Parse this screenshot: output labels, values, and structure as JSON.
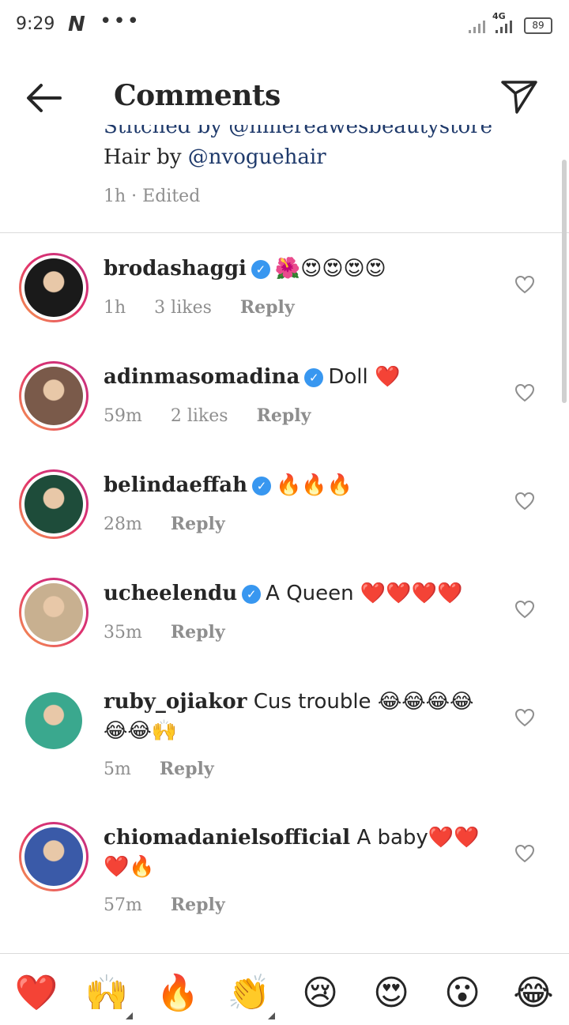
{
  "status": {
    "time": "9:29",
    "net": "4G",
    "battery": "89"
  },
  "header": {
    "title": "Comments",
    "back_icon": "arrow-left-icon",
    "send_icon": "paper-plane-icon"
  },
  "caption": {
    "cut_line": "Stitched by @nmereawesbeautystore",
    "line_prefix": "Hair by ",
    "mention": "@nvoguehair",
    "time": "1h",
    "sep": " · ",
    "edited": "Edited"
  },
  "comments": [
    {
      "user": "brodashaggi",
      "verified": true,
      "text": "🌺😍😍😍😍",
      "text2": "",
      "time": "1h",
      "likes": "3 likes",
      "reply": "Reply",
      "avatar_color": "#1a1a1a",
      "ring": true
    },
    {
      "user": "adinmasomadina",
      "verified": true,
      "text": "Doll ❤️",
      "text2": "",
      "time": "59m",
      "likes": "2 likes",
      "reply": "Reply",
      "avatar_color": "#7a5a4a",
      "ring": true
    },
    {
      "user": "belindaeffah",
      "verified": true,
      "text": "🔥🔥🔥",
      "text2": "",
      "time": "28m",
      "likes": "",
      "reply": "Reply",
      "avatar_color": "#1e4c3a",
      "ring": true
    },
    {
      "user": "ucheelendu",
      "verified": true,
      "text": "A Queen ❤️❤️❤️❤️",
      "text2": "",
      "time": "35m",
      "likes": "",
      "reply": "Reply",
      "avatar_color": "#c8b090",
      "ring": true
    },
    {
      "user": "ruby_ojiakor",
      "verified": false,
      "text": "Cus trouble 😂😂😂😂",
      "text2": "😂😂🙌",
      "time": "5m",
      "likes": "",
      "reply": "Reply",
      "avatar_color": "#3aa88e",
      "ring": false
    },
    {
      "user": "chiomadanielsofficial",
      "verified": false,
      "text": "A baby❤️❤️",
      "text2": "❤️🔥",
      "time": "57m",
      "likes": "",
      "reply": "Reply",
      "avatar_color": "#3a5aa8",
      "ring": true
    }
  ],
  "emoji_bar": [
    "❤️",
    "🙌",
    "🔥",
    "👏",
    "😢",
    "😍",
    "😮",
    "😂"
  ],
  "colors": {
    "accent": "#3897f0",
    "mention": "#1f3a6b",
    "meta": "#8e8e8e"
  }
}
